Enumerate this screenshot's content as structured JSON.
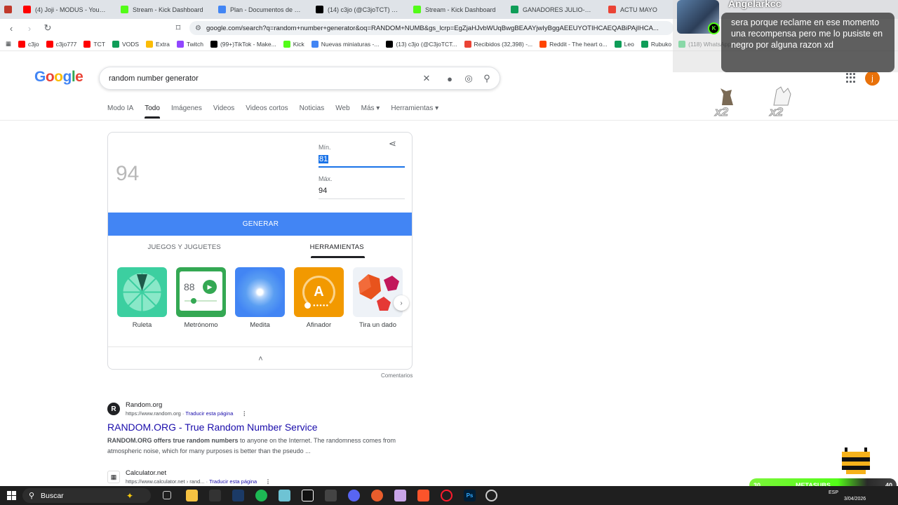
{
  "browser": {
    "tabs": [
      {
        "title": "(4) Joji - MODUS - YouTub",
        "color": "#ff0000"
      },
      {
        "title": "Stream - Kick Dashboard",
        "color": "#53fc18"
      },
      {
        "title": "Plan - Documentos de Google",
        "color": "#4285f4"
      },
      {
        "title": "(14) c3jo (@C3joTCT) / X",
        "color": "#000000"
      },
      {
        "title": "Stream - Kick Dashboard",
        "color": "#53fc18"
      },
      {
        "title": "GANADORES JULIO-OCT - Ho",
        "color": "#0f9d58"
      },
      {
        "title": "ACTU MAYO",
        "color": "#ea4335"
      }
    ],
    "url": "google.com/search?q=random+number+generator&oq=RANDOM+NUMB&gs_lcrp=EgZjaHJvbWUqBwgBEAAYjwIyBggAEEUYOTIHCAEQABiPAjIHCA...",
    "bookmarks": [
      {
        "label": "c3jo",
        "color": "#ff0000"
      },
      {
        "label": "c3jo777",
        "color": "#ff0000"
      },
      {
        "label": "TCT",
        "color": "#ff0000"
      },
      {
        "label": "VODS",
        "color": "#0f9d58"
      },
      {
        "label": "Extra",
        "color": "#fbbc05"
      },
      {
        "label": "Twitch",
        "color": "#9146ff"
      },
      {
        "label": "(99+)TikTok - Make...",
        "color": "#000000"
      },
      {
        "label": "Kick",
        "color": "#53fc18"
      },
      {
        "label": "Nuevas miniaturas -...",
        "color": "#4285f4"
      },
      {
        "label": "(13) c3jo (@C3joTCT...",
        "color": "#000000"
      },
      {
        "label": "Recibidos (32,398) -...",
        "color": "#ea4335"
      },
      {
        "label": "Reddit - The heart o...",
        "color": "#ff4500"
      },
      {
        "label": "Leo",
        "color": "#0f9d58"
      },
      {
        "label": "Rubuko",
        "color": "#0f9d58"
      },
      {
        "label": "(118) WhatsApp",
        "color": "#25d366"
      }
    ]
  },
  "google": {
    "logo_letters": [
      "G",
      "o",
      "o",
      "g",
      "l",
      "e"
    ],
    "query": "random number generator",
    "nav": [
      "Modo IA",
      "Todo",
      "Imágenes",
      "Videos",
      "Videos cortos",
      "Noticias",
      "Web",
      "Más ▾",
      "Herramientas ▾"
    ],
    "avatar_letter": "j"
  },
  "rng": {
    "result": "94",
    "min_label": "Mín.",
    "min_value": "81",
    "max_label": "Máx.",
    "max_value": "94",
    "generate_label": "GENERAR",
    "subtab_games": "JUEGOS Y JUGUETES",
    "subtab_tools": "HERRAMIENTAS",
    "tools": [
      {
        "label": "Ruleta"
      },
      {
        "label": "Metrónomo",
        "bpm": "88"
      },
      {
        "label": "Medita"
      },
      {
        "label": "Afinador",
        "note": "A"
      },
      {
        "label": "Tira un dado"
      }
    ],
    "feedback": "Comentarios"
  },
  "results": [
    {
      "site": "Random.org",
      "url": "https://www.random.org",
      "translate": "Traducir esta página",
      "title": "RANDOM.ORG - True Random Number Service",
      "snippet_bold": "RANDOM.ORG offers true random numbers",
      "snippet_rest": " to anyone on the Internet. The randomness comes from atmospheric noise, which for many purposes is better than the pseudo ..."
    },
    {
      "site": "Calculator.net",
      "url": "https://www.calculator.net › rand...",
      "translate": "Traducir esta página"
    }
  ],
  "overlay": {
    "username": "Angelarkcc",
    "message": "sera porque reclame en ese momento una recompensa pero me lo pusiste en negro por alguna razon xd",
    "x2_label": "x2",
    "metasubs_label": "METASUBS",
    "metasubs_current": "30",
    "metasubs_goal": "40"
  },
  "taskbar": {
    "search_label": "Buscar",
    "lang": "ESP",
    "date": "3/04/2026"
  }
}
